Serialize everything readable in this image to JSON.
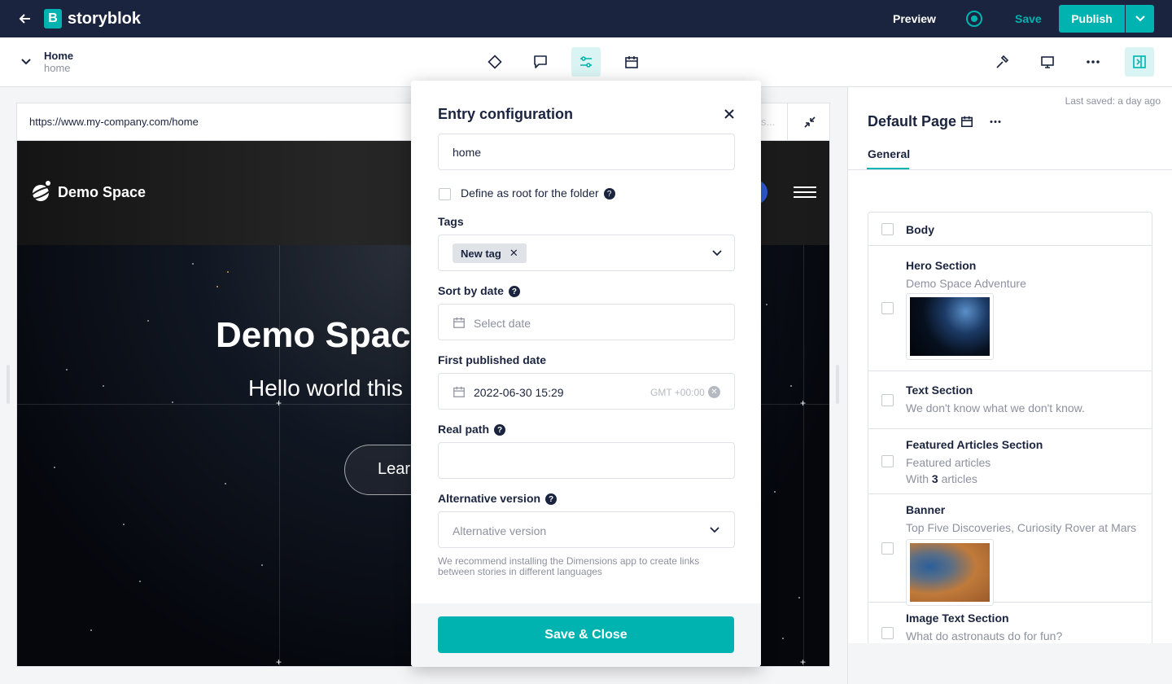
{
  "topbar": {
    "logo": "storyblok",
    "preview": "Preview",
    "save": "Save",
    "publish": "Publish"
  },
  "story": {
    "title": "Home",
    "slug": "home"
  },
  "preview": {
    "url": "https://www.my-company.com/home",
    "url_hint": "s...",
    "site_logo": "Demo Space",
    "hero_title": "Demo Spac",
    "hero_subtitle": "Hello world this",
    "hero_button": "Lear"
  },
  "modal": {
    "title": "Entry configuration",
    "name_value": "home",
    "root_label": "Define as root for the folder",
    "tags_label": "Tags",
    "tag": "New tag",
    "sort_label": "Sort by date",
    "sort_placeholder": "Select date",
    "first_pub_label": "First published date",
    "first_pub_value": "2022-06-30 15:29",
    "timezone": "GMT +00:00",
    "real_path_label": "Real path",
    "real_path_value": "",
    "alt_label": "Alternative version",
    "alt_placeholder": "Alternative version",
    "hint": "We recommend installing the Dimensions app to create links between stories in different languages",
    "save_close": "Save & Close"
  },
  "right_panel": {
    "last_saved": "Last saved: a day ago",
    "content_type": "Default Page",
    "tab": "General",
    "blocks": [
      {
        "title": "Body"
      },
      {
        "title": "Hero Section",
        "sub": "Demo Space Adventure"
      },
      {
        "title": "Text Section",
        "sub": "We don't know what we don't know."
      },
      {
        "title": "Featured Articles Section",
        "sub": "Featured articles",
        "extra_prefix": "With ",
        "extra_count": "3",
        "extra_suffix": " articles"
      },
      {
        "title": "Banner",
        "sub": "Top Five Discoveries, Curiosity Rover at Mars"
      },
      {
        "title": "Image Text Section",
        "sub": "What do astronauts do for fun?"
      }
    ]
  },
  "colors": {
    "navy": "#1b243f",
    "teal": "#00b3b0",
    "text_muted": "#8d919f"
  }
}
